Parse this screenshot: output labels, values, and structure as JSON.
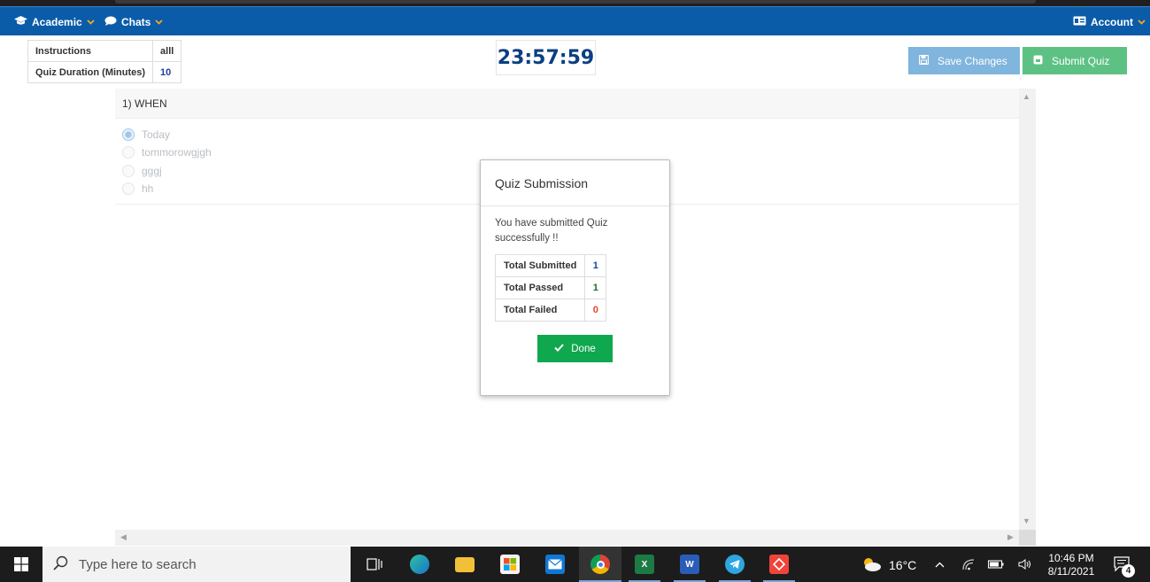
{
  "nav": {
    "academic": "Academic",
    "chats": "Chats",
    "account": "Account"
  },
  "info": {
    "instructions_label": "Instructions",
    "instructions_value": "alll",
    "duration_label": "Quiz Duration (Minutes)",
    "duration_value": "10"
  },
  "timer": "23:57:59",
  "buttons": {
    "save": "Save Changes",
    "submit": "Submit Quiz"
  },
  "question": {
    "title": "1) WHEN",
    "options": [
      {
        "label": "Today",
        "selected": true
      },
      {
        "label": "tommorowgjgh",
        "selected": false
      },
      {
        "label": "gggj",
        "selected": false
      },
      {
        "label": "hh",
        "selected": false
      }
    ]
  },
  "modal": {
    "title": "Quiz Submission",
    "message": "You have submitted Quiz successfully !!",
    "rows": [
      {
        "label": "Total Submitted",
        "value": "1"
      },
      {
        "label": "Total Passed",
        "value": "1"
      },
      {
        "label": "Total Failed",
        "value": "0"
      }
    ],
    "done": "Done"
  },
  "taskbar": {
    "search_placeholder": "Type here to search",
    "weather": "16°C",
    "time": "10:46 PM",
    "date": "8/11/2021",
    "notifications": "4"
  },
  "colors": {
    "navbar": "#0a5ca8",
    "timer": "#0b3f82",
    "save_button": "#80b5dd",
    "submit_button": "#5dc184",
    "done_button": "#10a84e",
    "passed": "#1c6b2e",
    "failed": "#e0472e"
  }
}
